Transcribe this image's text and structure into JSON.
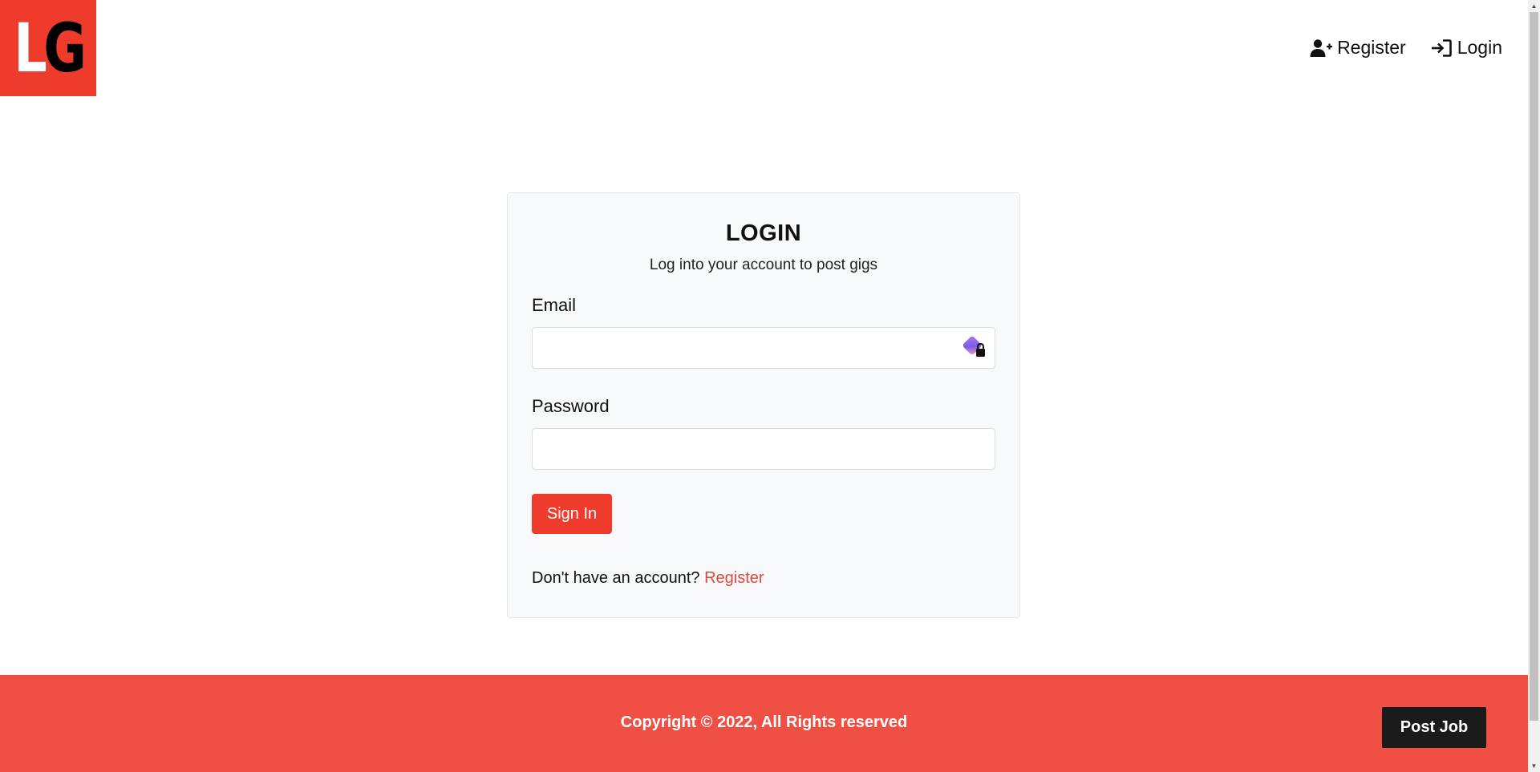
{
  "header": {
    "logo": {
      "letter1": "L",
      "letter2": "G"
    },
    "nav": [
      {
        "label": "Register",
        "icon": "user-plus-icon"
      },
      {
        "label": "Login",
        "icon": "sign-in-icon"
      }
    ]
  },
  "login_card": {
    "title": "LOGIN",
    "subtitle": "Log into your account to post gigs",
    "email_label": "Email",
    "email_value": "",
    "password_label": "Password",
    "password_value": "",
    "password_manager_icon": "password-manager-lock-icon",
    "submit_label": "Sign In",
    "register_prompt": "Don't have an account?",
    "register_link": "Register"
  },
  "footer": {
    "copyright": "Copyright © 2022, All Rights reserved",
    "post_job_label": "Post Job"
  },
  "colors": {
    "brand_red": "#ef3b2c",
    "footer_red": "#f04f43",
    "link_red": "#e0473d",
    "dark_button": "#1b1b1b",
    "card_background": "#f8f9fa"
  }
}
